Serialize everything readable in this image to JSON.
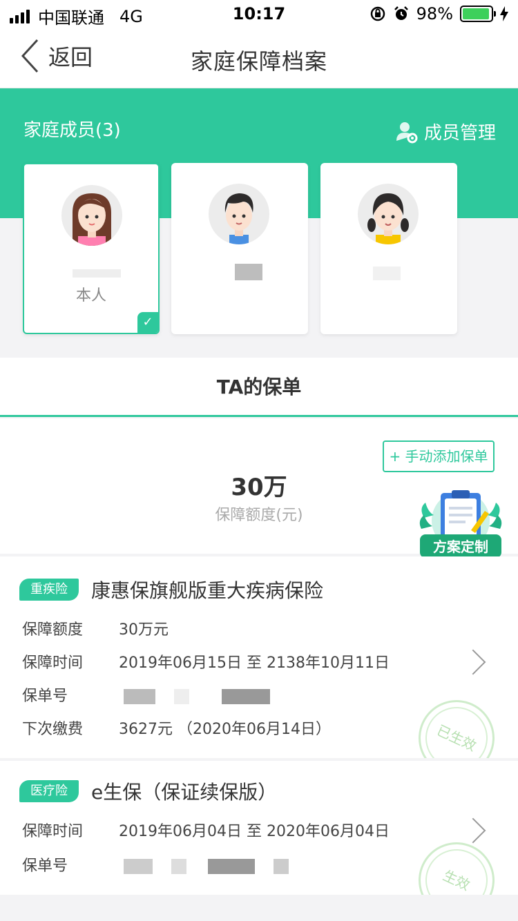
{
  "status_bar": {
    "carrier": "中国联通",
    "network": "4G",
    "time": "10:17",
    "battery_pct": "98%",
    "battery_color": "#3dd05b",
    "icons": [
      "signal-icon",
      "orientation-lock-icon",
      "alarm-icon",
      "battery-icon",
      "charging-icon"
    ]
  },
  "nav": {
    "back_label": "返回",
    "title": "家庭保障档案"
  },
  "family": {
    "title": "家庭成员(3)",
    "manage_label": "成员管理",
    "members": [
      {
        "avatar": "woman-avatar-icon",
        "role": "本人",
        "selected": true
      },
      {
        "avatar": "man-avatar-icon",
        "role": "",
        "selected": false
      },
      {
        "avatar": "girl-avatar-icon",
        "role": "",
        "selected": false
      }
    ]
  },
  "tab": {
    "label": "TA的保单"
  },
  "summary": {
    "add_button": "+ 手动添加保单",
    "amount": "30万",
    "amount_label": "保障额度(元)",
    "plan_badge": "方案定制"
  },
  "policies": [
    {
      "tag": "重疾险",
      "name": "康惠保旗舰版重大疾病保险",
      "rows": [
        {
          "key": "保障额度",
          "value": "30万元"
        },
        {
          "key": "保障时间",
          "value": "2019年06月15日 至 2138年10月11日"
        },
        {
          "key": "保单号",
          "value": ""
        },
        {
          "key": "下次缴费",
          "value": "3627元 （2020年06月14日）"
        }
      ],
      "stamp": "已生效"
    },
    {
      "tag": "医疗险",
      "name": "e生保（保证续保版）",
      "rows": [
        {
          "key": "保障时间",
          "value": "2019年06月04日 至 2020年06月04日"
        },
        {
          "key": "保单号",
          "value": ""
        }
      ],
      "stamp": "生效"
    }
  ],
  "colors": {
    "brand_green": "#2ec89c",
    "background": "#f3f3f5"
  }
}
